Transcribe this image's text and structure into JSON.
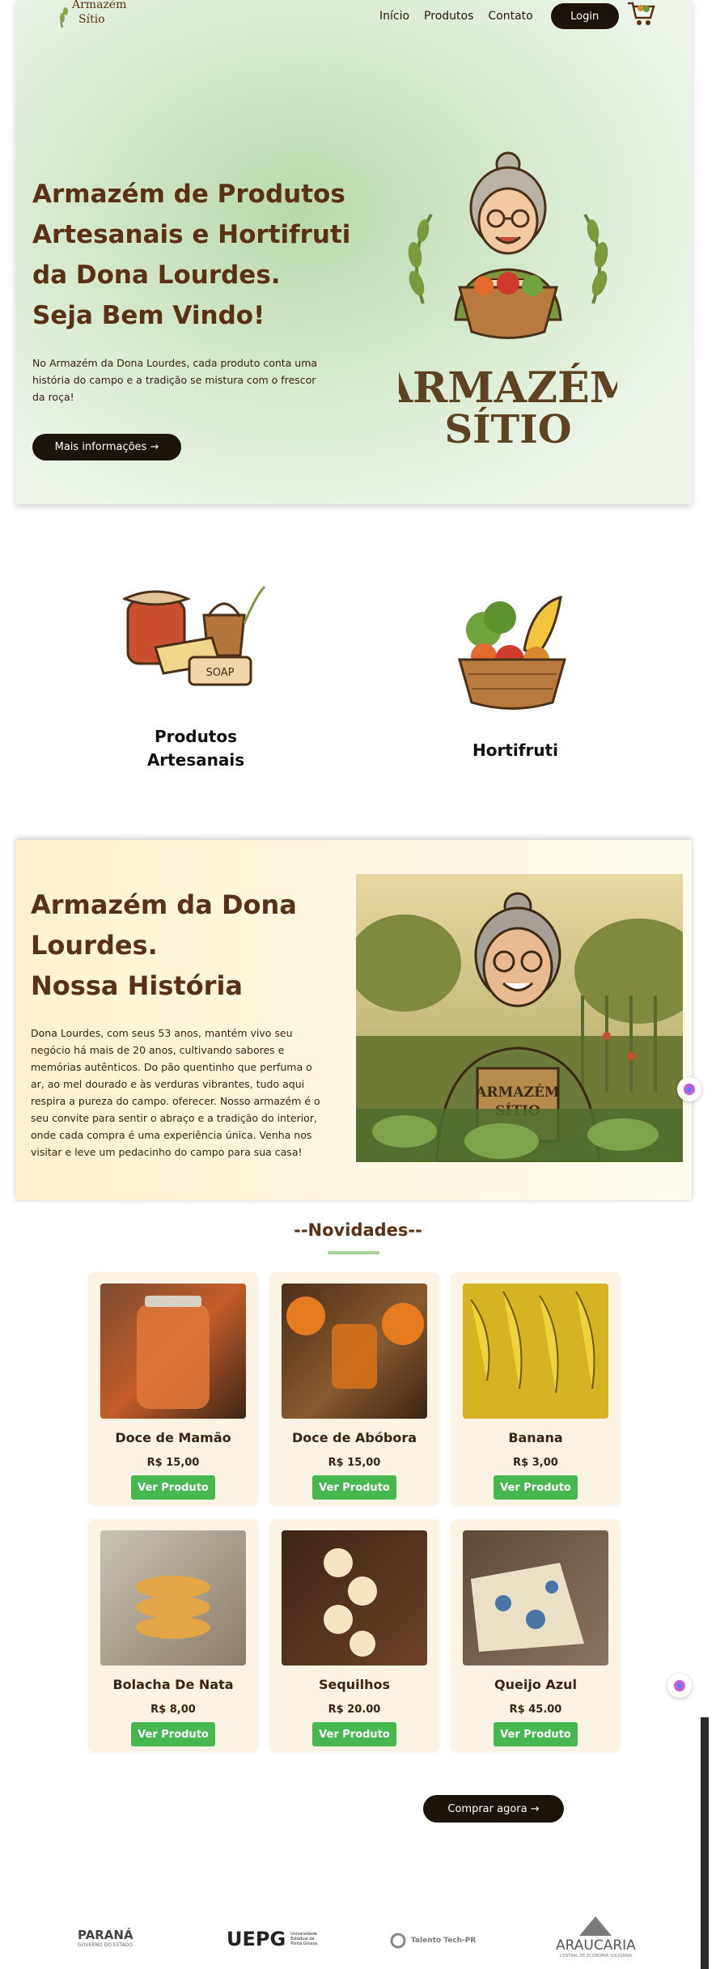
{
  "header": {
    "logo_text_line1": "Armazém",
    "logo_text_line2": "Sítio",
    "nav": [
      "Início",
      "Produtos",
      "Contato"
    ],
    "login_label": "Login",
    "cart_icon": "cart-icon"
  },
  "hero": {
    "title_lines": [
      "Armazém de Produtos",
      "Artesanais e Hortifruti",
      "da Dona Lourdes.",
      "Seja Bem Vindo!"
    ],
    "text": "No Armazém da Dona Lourdes, cada produto conta uma história do campo e a tradição se mistura com o frescor da roça!",
    "button_label": "Mais informações →",
    "logo_line1": "ARMAZÉM",
    "logo_line2": "SÍTIO"
  },
  "categories": [
    {
      "label_line1": "Produtos",
      "label_line2": "Artesanais",
      "icon": "artisanal-products-icon"
    },
    {
      "label_line1": "Hortifruti",
      "label_line2": "",
      "icon": "produce-basket-icon"
    }
  ],
  "history": {
    "title_lines": [
      "Armazém da Dona",
      "Lourdes.",
      "Nossa História"
    ],
    "text": "Dona Lourdes, com seus 53 anos, mantém vivo seu negócio há mais de 20 anos, cultivando sabores e memórias autênticos. Do pão quentinho que perfuma o ar, ao mel dourado e às verduras vibrantes, tudo aqui respira a pureza do campo. oferecer. Nosso armazém é o seu convite para sentir o abraço e a tradição do interior, onde cada compra é uma experiência única. Venha nos visitar e leve um pedacinho do campo para sua casa!",
    "apron_line1": "ARMAZÉM",
    "apron_line2": "SÍTIO"
  },
  "novidades": {
    "title": "--Novidades--",
    "button_label": "Ver Produto",
    "products": [
      {
        "name": "Doce de Mamão",
        "price": "R$ 15,00"
      },
      {
        "name": "Doce de Abóbora",
        "price": "R$ 15,00"
      },
      {
        "name": "Banana",
        "price": "R$ 3,00"
      },
      {
        "name": "Bolacha De Nata",
        "price": "R$ 8,00"
      },
      {
        "name": "Sequilhos",
        "price": "R$ 20.00"
      },
      {
        "name": "Queijo Azul",
        "price": "R$ 45.00"
      }
    ]
  },
  "cta": {
    "label": "Comprar agora →"
  },
  "partners": {
    "parana": "PARANÁ",
    "parana_sub": "GOVERNO DO ESTADO",
    "uepg": "UEPG",
    "uepg_sub": "Universidade Estadual de Ponta Grossa",
    "talento": "Talento Tech-PR",
    "araucaria": "ARAUCARIA",
    "araucaria_sub": "CENTRAL DE ECONOMIA SOLIDÁRIA"
  },
  "colors": {
    "accent_brown": "#5a3114",
    "dark_button": "#1c130a",
    "green_button": "#46b84f",
    "hero_green": "#b9d9ac",
    "history_cream": "#fff2cc"
  }
}
